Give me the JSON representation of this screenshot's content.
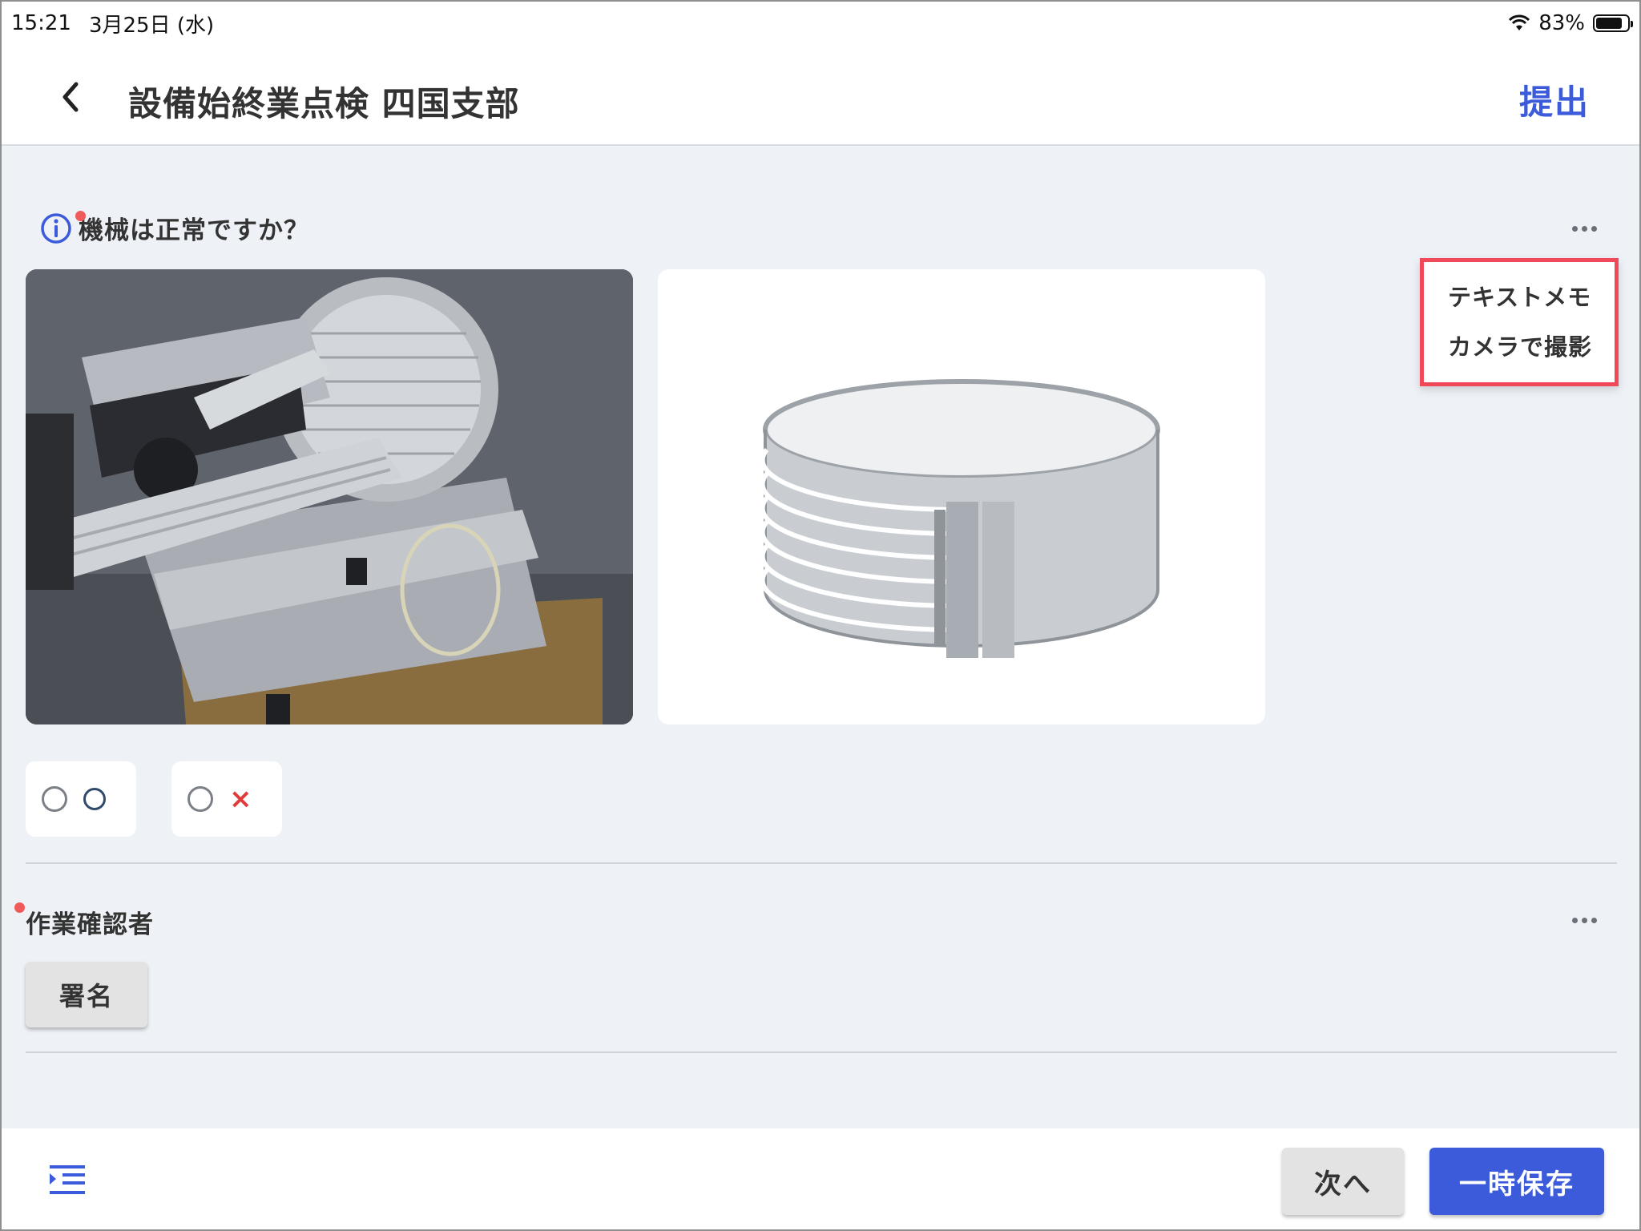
{
  "status_bar": {
    "time": "15:21",
    "date": "3月25日 (水)",
    "battery": "83%",
    "battery_level": 0.83,
    "icons": [
      "wifi-icon",
      "battery-icon"
    ]
  },
  "header": {
    "title": "設備始終業点検 四国支部",
    "submit_label": "提出",
    "back_icon": "chevron-left-icon"
  },
  "question": {
    "label": "機械は正常ですか？",
    "required": true,
    "choices": [
      {
        "mark": "○"
      },
      {
        "mark": "×"
      }
    ]
  },
  "context_menu": {
    "items": [
      "テキストメモ",
      "カメラで撮影"
    ]
  },
  "signature_section": {
    "label": "作業確認者",
    "required": true,
    "sign_label": "署名"
  },
  "footer": {
    "next_label": "次へ",
    "save_label": "一時保存",
    "outline_icon": "outline-list-icon"
  },
  "colors": {
    "accent": "#3b5bdb",
    "required_dot": "#f05a5a",
    "menu_highlight": "#f04a5a",
    "background": "#eef1f6"
  }
}
